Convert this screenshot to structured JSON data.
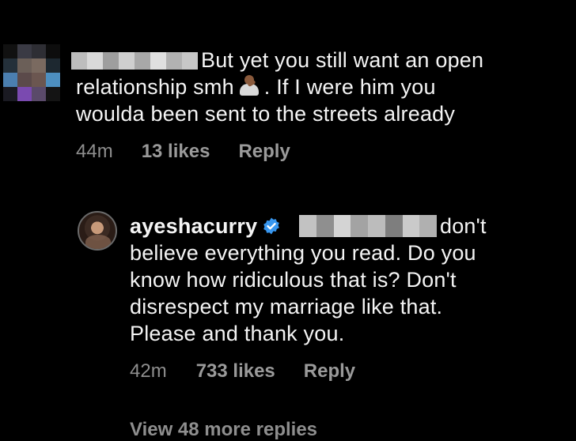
{
  "comment1": {
    "line1": "But yet you still want an open",
    "line2_a": "relationship smh",
    "line2_b": ". If I were him you",
    "line3": "woulda been sent to the streets already",
    "time": "44m",
    "likes": "13 likes",
    "reply": "Reply",
    "emoji_icon": "man-shrugging-emoji"
  },
  "comment2": {
    "username": "ayeshacurry",
    "line1_tail": "don't",
    "line2": "believe everything you read. Do you",
    "line3": "know how ridiculous that is? Don't",
    "line4": "disrespect my marriage like that.",
    "line5": "Please and thank you.",
    "time": "42m",
    "likes": "733 likes",
    "reply": "Reply"
  },
  "view_more": "View 48 more replies",
  "colors": {
    "background": "#000000",
    "text": "#f4f4f4",
    "meta": "#8e8e8e",
    "verified": "#3897f0"
  }
}
